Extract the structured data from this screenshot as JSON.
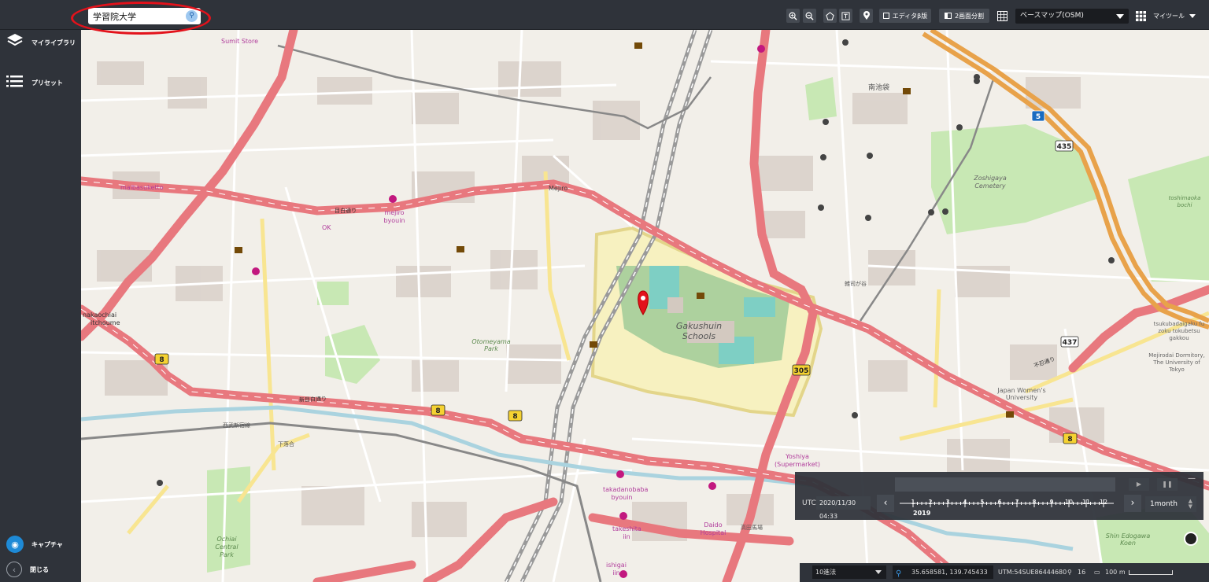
{
  "search": {
    "value": "学習院大学",
    "button_icon": "search-icon"
  },
  "toolbar": {
    "zoom_in_icon": "zoom-in-icon",
    "zoom_out_icon": "zoom-out-icon",
    "polygon_icon": "pentagon-icon",
    "text_icon": "text-icon",
    "marker_icon": "map-pin-icon",
    "editor_label": "エディタβ版",
    "split_label": "2画面分割",
    "basemap_select": "ベースマップ(OSM)",
    "my_tools_label": "マイツール"
  },
  "sidebar": {
    "items": [
      {
        "label": "マイライブラリ",
        "icon": "layers-icon"
      },
      {
        "label": "プリセット",
        "icon": "list-icon"
      }
    ],
    "capture_label": "キャプチャ",
    "close_label": "閉じる"
  },
  "map": {
    "place_labels": [
      "Sumit Store",
      "南池袋",
      "Zoshigaya Cemetery",
      "Mejiro",
      "Gakushuin Schools",
      "Otomeyama Park",
      "nakaochiai",
      "itchoume",
      "Japan Women's University",
      "maibasuketto",
      "OK",
      "mejiro byouin",
      "Yoshiya (Supermarket)",
      "Daido Hospital",
      "takadanobaba byouin",
      "takeshita iin",
      "ishigai iin",
      "Ochiai Central Park",
      "tsukubadaigaku fu zoku tokubetsu gakkou",
      "Mejirodai Dormitory, The University of Tokyo",
      "Shin Edogawa Koen",
      "toshimaoka bochi",
      "新目白通り",
      "目白通り",
      "不忍通り",
      "雑司が谷",
      "高田馬場",
      "下落合",
      "西武新宿線"
    ],
    "route_shields": [
      "8",
      "8",
      "8",
      "305",
      "435",
      "437",
      "5",
      "8"
    ]
  },
  "timeline": {
    "utc_label": "UTC",
    "datetime": "2020/11/30 04:33",
    "year": "2019",
    "months": [
      "1",
      "2",
      "3",
      "4",
      "5",
      "6",
      "7",
      "8",
      "9",
      "10",
      "11",
      "12"
    ],
    "period": "1month",
    "prev_icon": "chevron-left-icon",
    "next_icon": "chevron-right-icon"
  },
  "status": {
    "coord_system": "10進法",
    "latlon": "35.658581, 139.745433",
    "utm": "UTM:54SUE86444680",
    "zoom": "16",
    "scale": "100 m"
  },
  "colors": {
    "map_bg": "#f2efe9",
    "primary_road": "#e8787e",
    "secondary_road": "#f8e591",
    "park": "#c8e8b4",
    "building": "#d9d0c9",
    "ui_dark": "#2f333a",
    "highlight": "#e3121b",
    "accent_blue": "#1e8ad6"
  }
}
